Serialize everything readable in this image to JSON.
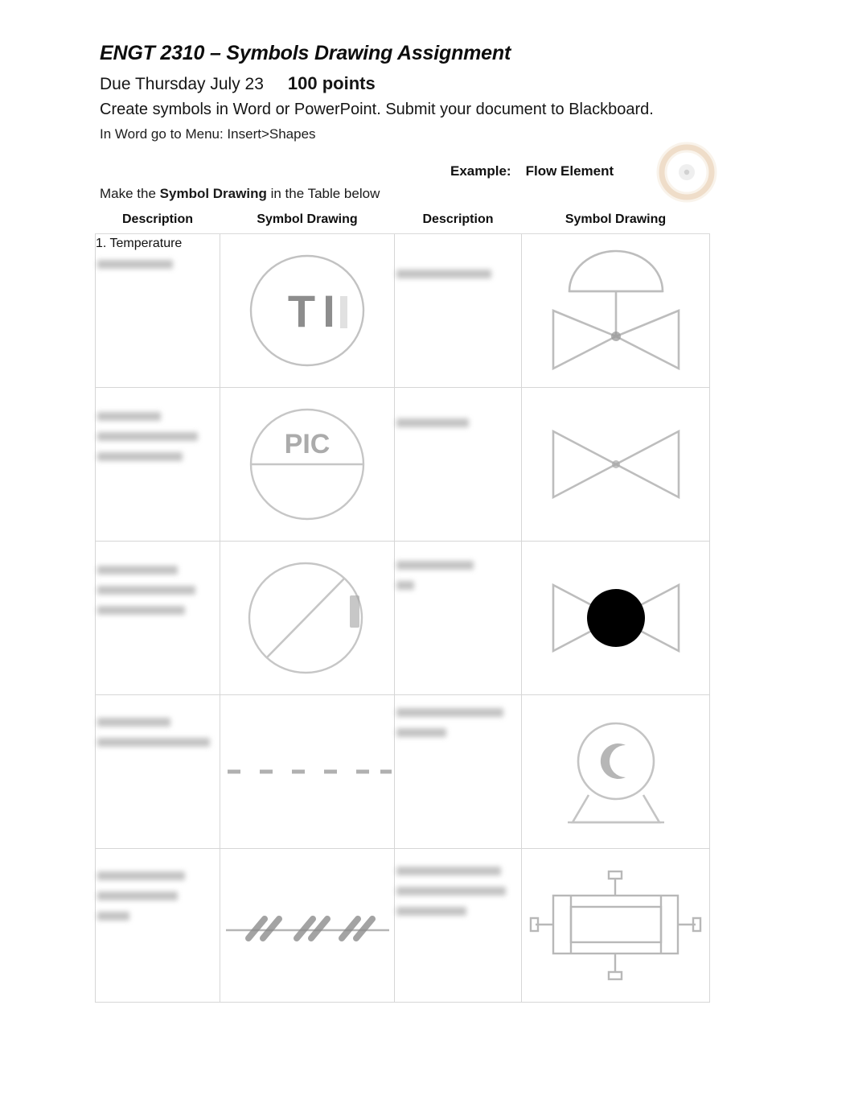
{
  "document": {
    "title": "ENGT 2310 – Symbols Drawing Assignment",
    "due_line": "Due Thursday July 23",
    "points": "100 points",
    "instruction_main": "Create symbols in Word or PowerPoint. Submit your document to Blackboard.",
    "instruction_sub": "In Word go to Menu: Insert>Shapes",
    "example_label": "Example:",
    "example_value": "Flow Element",
    "make_symbol_prefix": "Make the ",
    "make_symbol_bold": "Symbol Drawing",
    "make_symbol_suffix": " in the Table below"
  },
  "table": {
    "headers": [
      "Description",
      "Symbol Drawing",
      "Description",
      "Symbol Drawing"
    ],
    "rows": [
      {
        "left_description": "1.  Temperature",
        "left_description_blurred": [
          "blurred"
        ],
        "left_symbol": "circle-ti-instrument-bubble",
        "right_description_blurred": [
          "blurred"
        ],
        "right_symbol": "diaphragm-control-valve"
      },
      {
        "left_description": "",
        "left_description_blurred": [
          "blurred",
          "blurred",
          "blurred"
        ],
        "left_symbol": "circle-pic-shared-display",
        "right_description_blurred": [
          "blurred"
        ],
        "right_symbol": "gate-valve-bowtie"
      },
      {
        "left_description": "",
        "left_description_blurred": [
          "blurred",
          "blurred",
          "blurred"
        ],
        "left_symbol": "circle-diagonal-line-symbol",
        "right_description_blurred": [
          "blurred",
          "blurred"
        ],
        "right_symbol": "ball-valve-filled-circle"
      },
      {
        "left_description": "",
        "left_description_blurred": [
          "blurred",
          "blurred"
        ],
        "left_symbol": "dashed-electrical-signal-line",
        "right_description_blurred": [
          "blurred",
          "blurred"
        ],
        "right_symbol": "centrifugal-pump"
      },
      {
        "left_description": "",
        "left_description_blurred": [
          "blurred",
          "blurred",
          "blurred"
        ],
        "left_symbol": "pneumatic-signal-line",
        "right_description_blurred": [
          "blurred",
          "blurred",
          "blurred"
        ],
        "right_symbol": "shell-and-tube-heat-exchanger"
      }
    ]
  },
  "colors": {
    "page_background": "#ffffff",
    "text": "#111111",
    "table_border": "#d6d6d6",
    "symbol_stroke": "#b9b9b9",
    "symbol_fill_black": "#000000",
    "example_symbol_ring": "#e8c9a6"
  }
}
